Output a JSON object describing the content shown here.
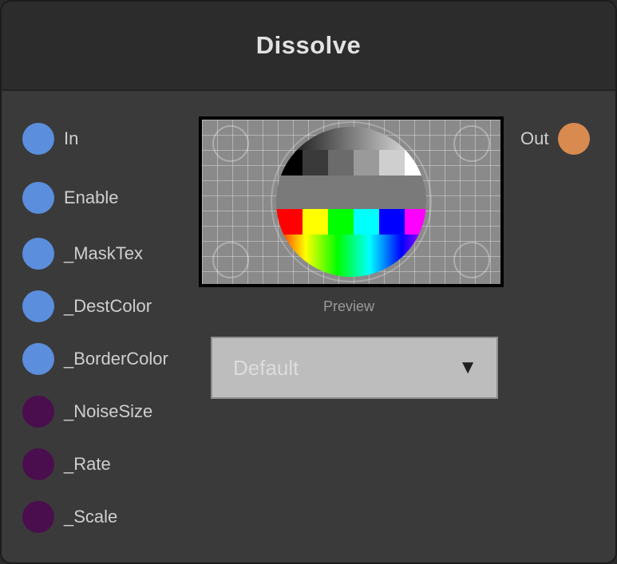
{
  "node": {
    "title": "Dissolve"
  },
  "inputs": [
    {
      "label": "In",
      "color": "#5b8edc"
    },
    {
      "label": "Enable",
      "color": "#5b8edc"
    },
    {
      "label": "_MaskTex",
      "color": "#5b8edc"
    },
    {
      "label": "_DestColor",
      "color": "#5b8edc"
    },
    {
      "label": "_BorderColor",
      "color": "#5b8edc"
    },
    {
      "label": "_NoiseSize",
      "color": "#4a0e4e"
    },
    {
      "label": "_Rate",
      "color": "#4a0e4e"
    },
    {
      "label": "_Scale",
      "color": "#4a0e4e"
    }
  ],
  "outputs": [
    {
      "label": "Out",
      "color": "#d98a4f"
    }
  ],
  "preview": {
    "caption": "Preview"
  },
  "dropdown": {
    "value": "Default",
    "arrow_icon": "triangle-down-icon"
  }
}
